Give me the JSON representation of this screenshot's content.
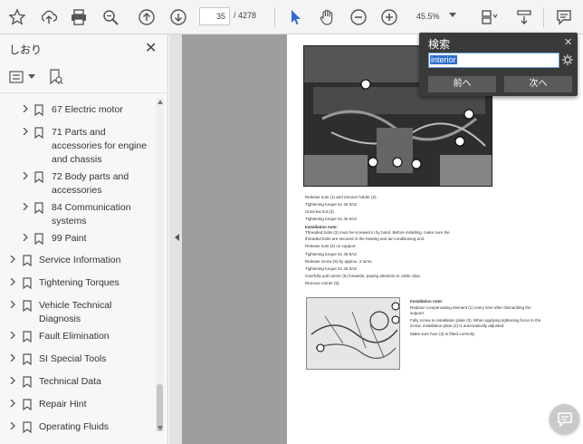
{
  "toolbar": {
    "page_current": "35",
    "page_total": "/ 4278",
    "zoom": "45.5%",
    "icons": [
      "star-icon",
      "upload-icon",
      "print-icon",
      "zoom-search-icon",
      "page-up-icon",
      "page-down-icon",
      "select-cursor-icon",
      "hand-icon",
      "zoom-out-icon",
      "zoom-in-icon",
      "fit-page-icon",
      "scroll-mode-icon",
      "comment-icon"
    ]
  },
  "sidebar": {
    "title": "しおり",
    "bookmarks_child": [
      {
        "label": "67 Electric motor"
      },
      {
        "label": "71 Parts and accessories for engine and chassis"
      },
      {
        "label": "72 Body parts and accessories"
      },
      {
        "label": "84 Communication systems"
      },
      {
        "label": "99 Paint"
      }
    ],
    "bookmarks_top": [
      {
        "label": "Service Information"
      },
      {
        "label": "Tightening Torques"
      },
      {
        "label": "Vehicle Technical Diagnosis"
      },
      {
        "label": "Fault Elimination"
      },
      {
        "label": "SI Special Tools"
      },
      {
        "label": "Technical Data"
      },
      {
        "label": "Repair Hint"
      },
      {
        "label": "Operating Fluids"
      }
    ]
  },
  "find": {
    "title": "検索",
    "query": "interior",
    "prev_label": "前へ",
    "next_label": "次へ"
  },
  "doc": {
    "lines": [
      "Release nuts (1) and remove holder (2).",
      "Tightening torque 51 45 8AZ.",
      "Unscrew nut (3).",
      "Tightening torque 51 45 8AZ.",
      "Installation note:",
      "Threaded bolts (3) must be screwed in by hand. Before installing, make sure the",
      "threaded bolts are secured in the heating and air-conditioning unit.",
      "Release nuts (4) on support.",
      "Tightening torque 51 45 8AZ.",
      "Release screw (5) by approx. 2 turns.",
      "Tightening torque 51 45 8AZ.",
      "Carefully pull carrier (6) forwards, paying attention to cable clips.",
      "Remove carrier (6)."
    ],
    "note_title": "Installation note:",
    "note_lines": [
      "Replace compensating element (1) every time after dismantling the",
      "support.",
      "Fully screw in installation plate (3). When applying tightening force to the",
      "screw, installation plate (2) is automatically adjusted.",
      "Make sure fuse (3) is fitted correctly."
    ]
  }
}
